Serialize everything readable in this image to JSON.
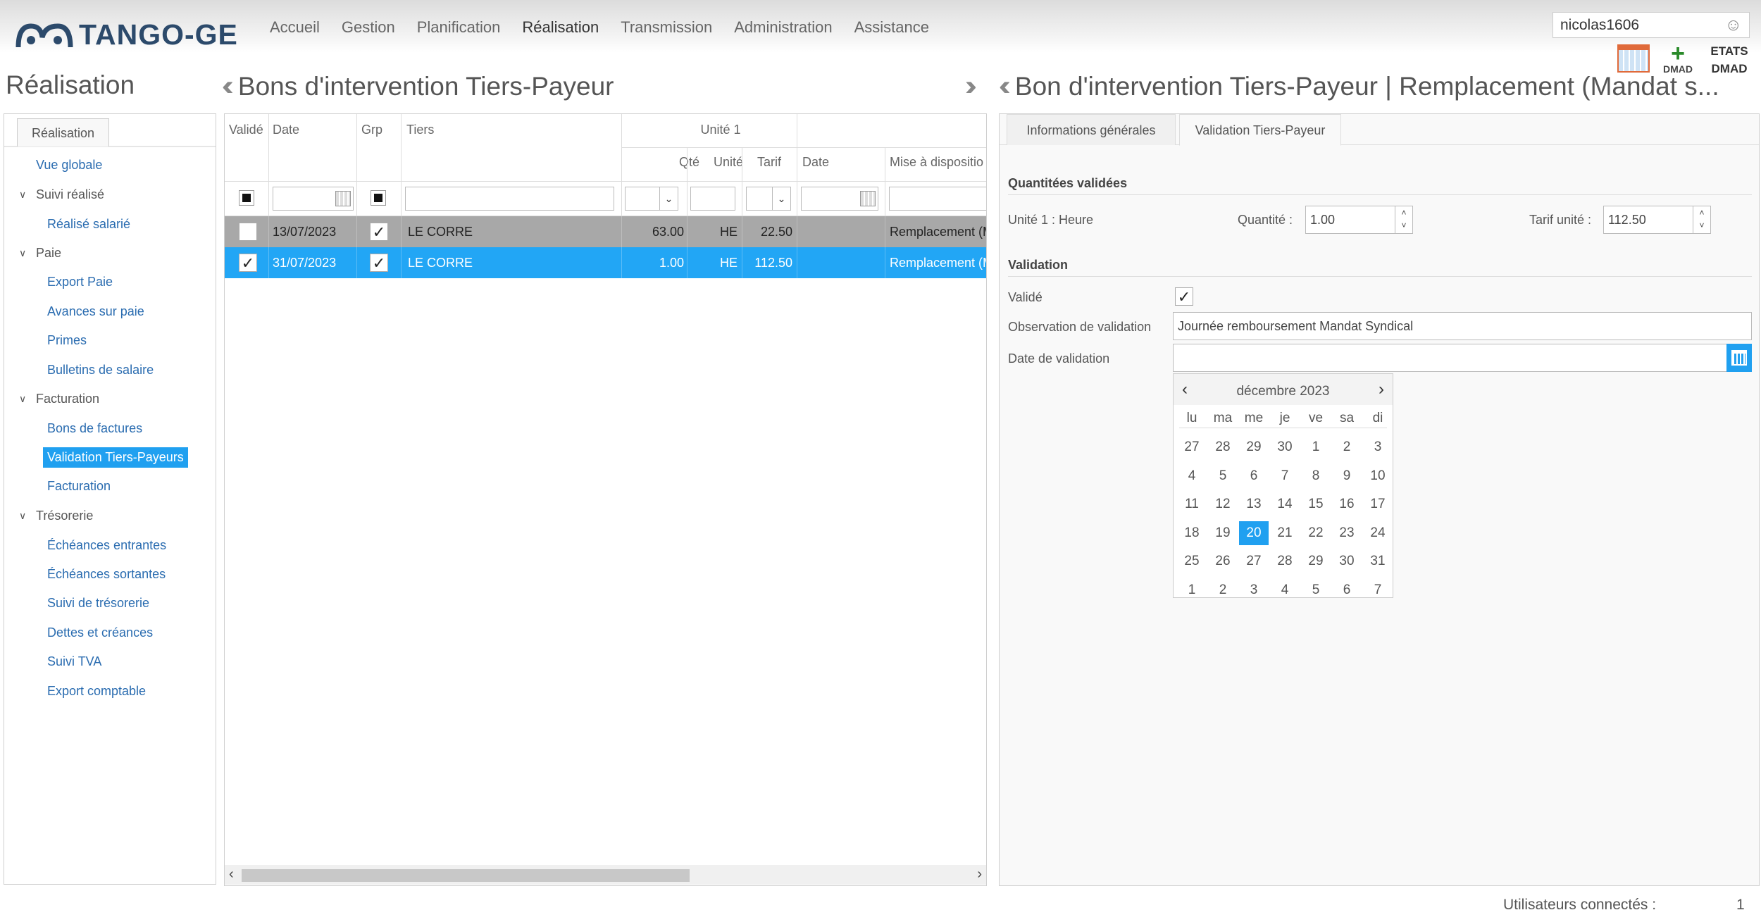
{
  "header": {
    "brand": "TANGO-GE",
    "menu": [
      "Accueil",
      "Gestion",
      "Planification",
      "Réalisation",
      "Transmission",
      "Administration",
      "Assistance"
    ],
    "active_menu": "Réalisation",
    "username": "nicolas1606",
    "dmad_label": "DMAD",
    "etats_label_1": "ETATS",
    "etats_label_2": "DMAD"
  },
  "titles": {
    "left": "Réalisation",
    "middle": "Bons d'intervention Tiers-Payeur",
    "right": "Bon d'intervention Tiers-Payeur | Remplacement (Mandat s..."
  },
  "sidebar": {
    "tab": "Réalisation",
    "items": [
      {
        "label": "Vue globale",
        "kind": "link"
      },
      {
        "label": "Suivi réalisé",
        "kind": "group"
      },
      {
        "label": "Réalisé salarié",
        "kind": "link"
      },
      {
        "label": "Paie",
        "kind": "group"
      },
      {
        "label": "Export Paie",
        "kind": "link"
      },
      {
        "label": "Avances sur paie",
        "kind": "link"
      },
      {
        "label": "Primes",
        "kind": "link"
      },
      {
        "label": "Bulletins de salaire",
        "kind": "link"
      },
      {
        "label": "Facturation",
        "kind": "group"
      },
      {
        "label": "Bons de factures",
        "kind": "link"
      },
      {
        "label": "Validation Tiers-Payeurs",
        "kind": "link",
        "active": true
      },
      {
        "label": "Facturation",
        "kind": "link"
      },
      {
        "label": "Trésorerie",
        "kind": "group"
      },
      {
        "label": "Échéances entrantes",
        "kind": "link"
      },
      {
        "label": "Échéances sortantes",
        "kind": "link"
      },
      {
        "label": "Suivi de trésorerie",
        "kind": "link"
      },
      {
        "label": "Dettes et créances",
        "kind": "link"
      },
      {
        "label": "Suivi TVA",
        "kind": "link"
      },
      {
        "label": "Export comptable",
        "kind": "link"
      }
    ]
  },
  "grid": {
    "headers": {
      "valide": "Validé",
      "date": "Date",
      "grp": "Grp",
      "tiers": "Tiers",
      "unite1": "Unité 1",
      "qte": "Qté",
      "unite": "Unité",
      "tarif": "Tarif",
      "date2": "Date",
      "mise": "Mise à dispositio"
    },
    "rows": [
      {
        "valide": "",
        "date": "13/07/2023",
        "grp": "✓",
        "tiers": "LE CORRE",
        "qte": "63.00",
        "unite": "HE",
        "tarif": "22.50",
        "date2": "",
        "mise": "Remplacement (M"
      },
      {
        "valide": "✓",
        "date": "31/07/2023",
        "grp": "✓",
        "tiers": "LE CORRE",
        "qte": "1.00",
        "unite": "HE",
        "tarif": "112.50",
        "date2": "",
        "mise": "Remplacement (M"
      }
    ]
  },
  "detail": {
    "tabs": [
      "Informations générales",
      "Validation Tiers-Payeur"
    ],
    "active_tab": "Validation Tiers-Payeur",
    "section_quantites": "Quantitées validées",
    "unite_label": "Unité 1 : Heure",
    "quantite_label": "Quantité :",
    "quantite_value": "1.00",
    "tarif_label": "Tarif unité :",
    "tarif_value": "112.50",
    "section_validation": "Validation",
    "valide_label": "Validé",
    "valide_checked": "✓",
    "observation_label": "Observation de validation",
    "observation_value": "Journée remboursement Mandat Syndical",
    "date_label": "Date de validation",
    "date_value": ""
  },
  "calendar": {
    "month": "décembre 2023",
    "weekdays": [
      "lu",
      "ma",
      "me",
      "je",
      "ve",
      "sa",
      "di"
    ],
    "weeks": [
      [
        "27",
        "28",
        "29",
        "30",
        "1",
        "2",
        "3"
      ],
      [
        "4",
        "5",
        "6",
        "7",
        "8",
        "9",
        "10"
      ],
      [
        "11",
        "12",
        "13",
        "14",
        "15",
        "16",
        "17"
      ],
      [
        "18",
        "19",
        "20",
        "21",
        "22",
        "23",
        "24"
      ],
      [
        "25",
        "26",
        "27",
        "28",
        "29",
        "30",
        "31"
      ],
      [
        "1",
        "2",
        "3",
        "4",
        "5",
        "6",
        "7"
      ]
    ],
    "today": "20"
  },
  "footer": {
    "label": "Utilisateurs connectés :",
    "count": "1"
  },
  "colors": {
    "accent": "#20a0f0",
    "selected_row": "#22a6f5",
    "grey_row": "#a8a8a8",
    "brand": "#2c4a6b"
  }
}
